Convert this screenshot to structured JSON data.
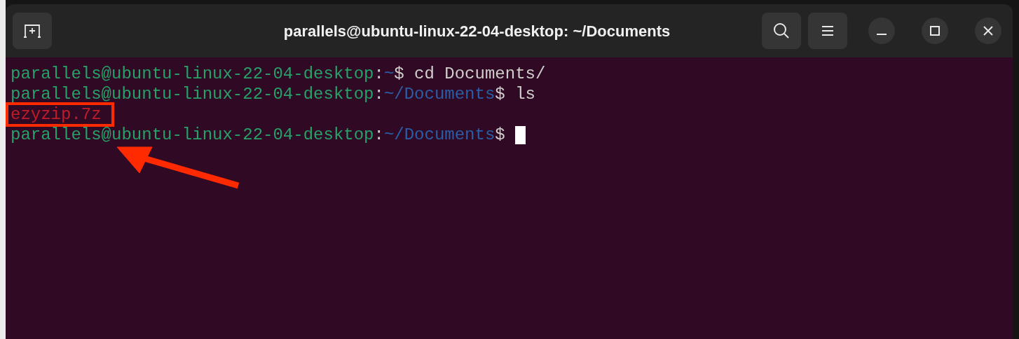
{
  "window": {
    "title": "parallels@ubuntu-linux-22-04-desktop: ~/Documents"
  },
  "terminal": {
    "lines": [
      [
        {
          "kind": "user",
          "text": "parallels@ubuntu-linux-22-04-desktop"
        },
        {
          "kind": "plain",
          "text": ":"
        },
        {
          "kind": "path",
          "text": "~"
        },
        {
          "kind": "plain",
          "text": "$ cd Documents/"
        }
      ],
      [
        {
          "kind": "user",
          "text": "parallels@ubuntu-linux-22-04-desktop"
        },
        {
          "kind": "plain",
          "text": ":"
        },
        {
          "kind": "path",
          "text": "~/Documents"
        },
        {
          "kind": "plain",
          "text": "$ ls"
        }
      ],
      [
        {
          "kind": "file",
          "text": "ezyzip.7z"
        }
      ],
      [
        {
          "kind": "user",
          "text": "parallels@ubuntu-linux-22-04-desktop"
        },
        {
          "kind": "plain",
          "text": ":"
        },
        {
          "kind": "path",
          "text": "~/Documents"
        },
        {
          "kind": "plain",
          "text": "$ "
        },
        {
          "kind": "cursor"
        }
      ]
    ]
  }
}
